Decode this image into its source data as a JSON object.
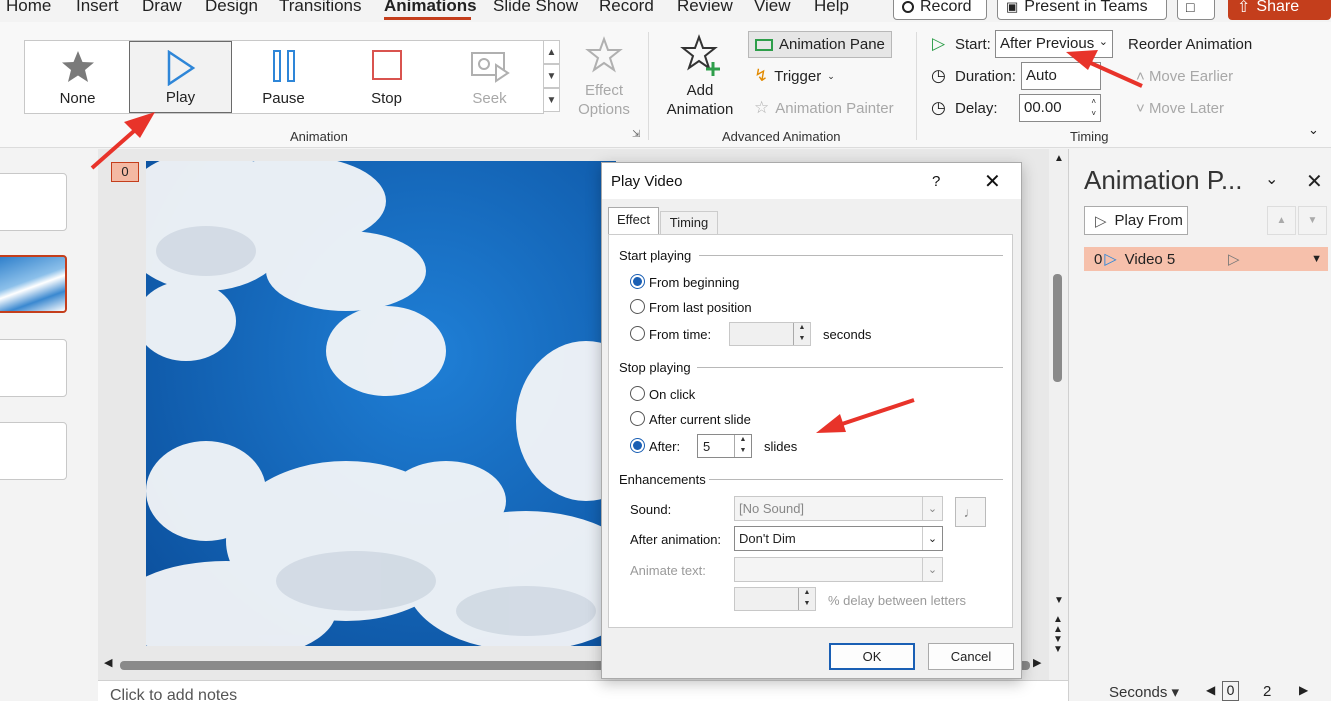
{
  "menu": {
    "items": [
      "Home",
      "Insert",
      "Draw",
      "Design",
      "Transitions",
      "Animations",
      "Slide Show",
      "Record",
      "Review",
      "View",
      "Help"
    ],
    "record_btn": "Record",
    "present_btn": "Present in Teams",
    "share_btn": "Share"
  },
  "ribbon": {
    "gallery": [
      "None",
      "Play",
      "Pause",
      "Stop",
      "Seek"
    ],
    "effect_options": "Effect Options",
    "animation_group": "Animation",
    "add_animation": "Add Animation",
    "animation_pane": "Animation Pane",
    "trigger": "Trigger",
    "animation_painter": "Animation Painter",
    "advanced_group": "Advanced Animation",
    "start_label": "Start:",
    "start_value": "After Previous",
    "duration_label": "Duration:",
    "duration_value": "Auto",
    "delay_label": "Delay:",
    "delay_value": "00.00",
    "reorder": "Reorder Animation",
    "move_earlier": "Move Earlier",
    "move_later": "Move Later",
    "timing_group": "Timing"
  },
  "slide": {
    "anim_tag": "0",
    "notes_placeholder": "Click to add notes"
  },
  "pane": {
    "title": "Animation P...",
    "play_from": "Play From",
    "item_index": "0",
    "item_label": "Video 5",
    "seconds": "Seconds",
    "scale_start": "0",
    "scale_mark": "2"
  },
  "dialog": {
    "title": "Play Video",
    "help": "?",
    "tab_effect": "Effect",
    "tab_timing": "Timing",
    "start_section": "Start playing",
    "from_beginning": "From beginning",
    "from_last": "From last position",
    "from_time": "From time:",
    "seconds": "seconds",
    "stop_section": "Stop playing",
    "on_click": "On click",
    "after_current": "After current slide",
    "after": "After:",
    "after_value": "5",
    "slides": "slides",
    "enh_section": "Enhancements",
    "sound_label": "Sound:",
    "sound_value": "[No Sound]",
    "after_anim_label": "After animation:",
    "after_anim_value": "Don't Dim",
    "animate_text_label": "Animate text:",
    "delay_letters": "% delay between letters",
    "ok": "OK",
    "cancel": "Cancel"
  },
  "colors": {
    "accent": "#c43e1c",
    "selected_pane_item": "#f6c0ab",
    "radio": "#1a5fb4"
  }
}
